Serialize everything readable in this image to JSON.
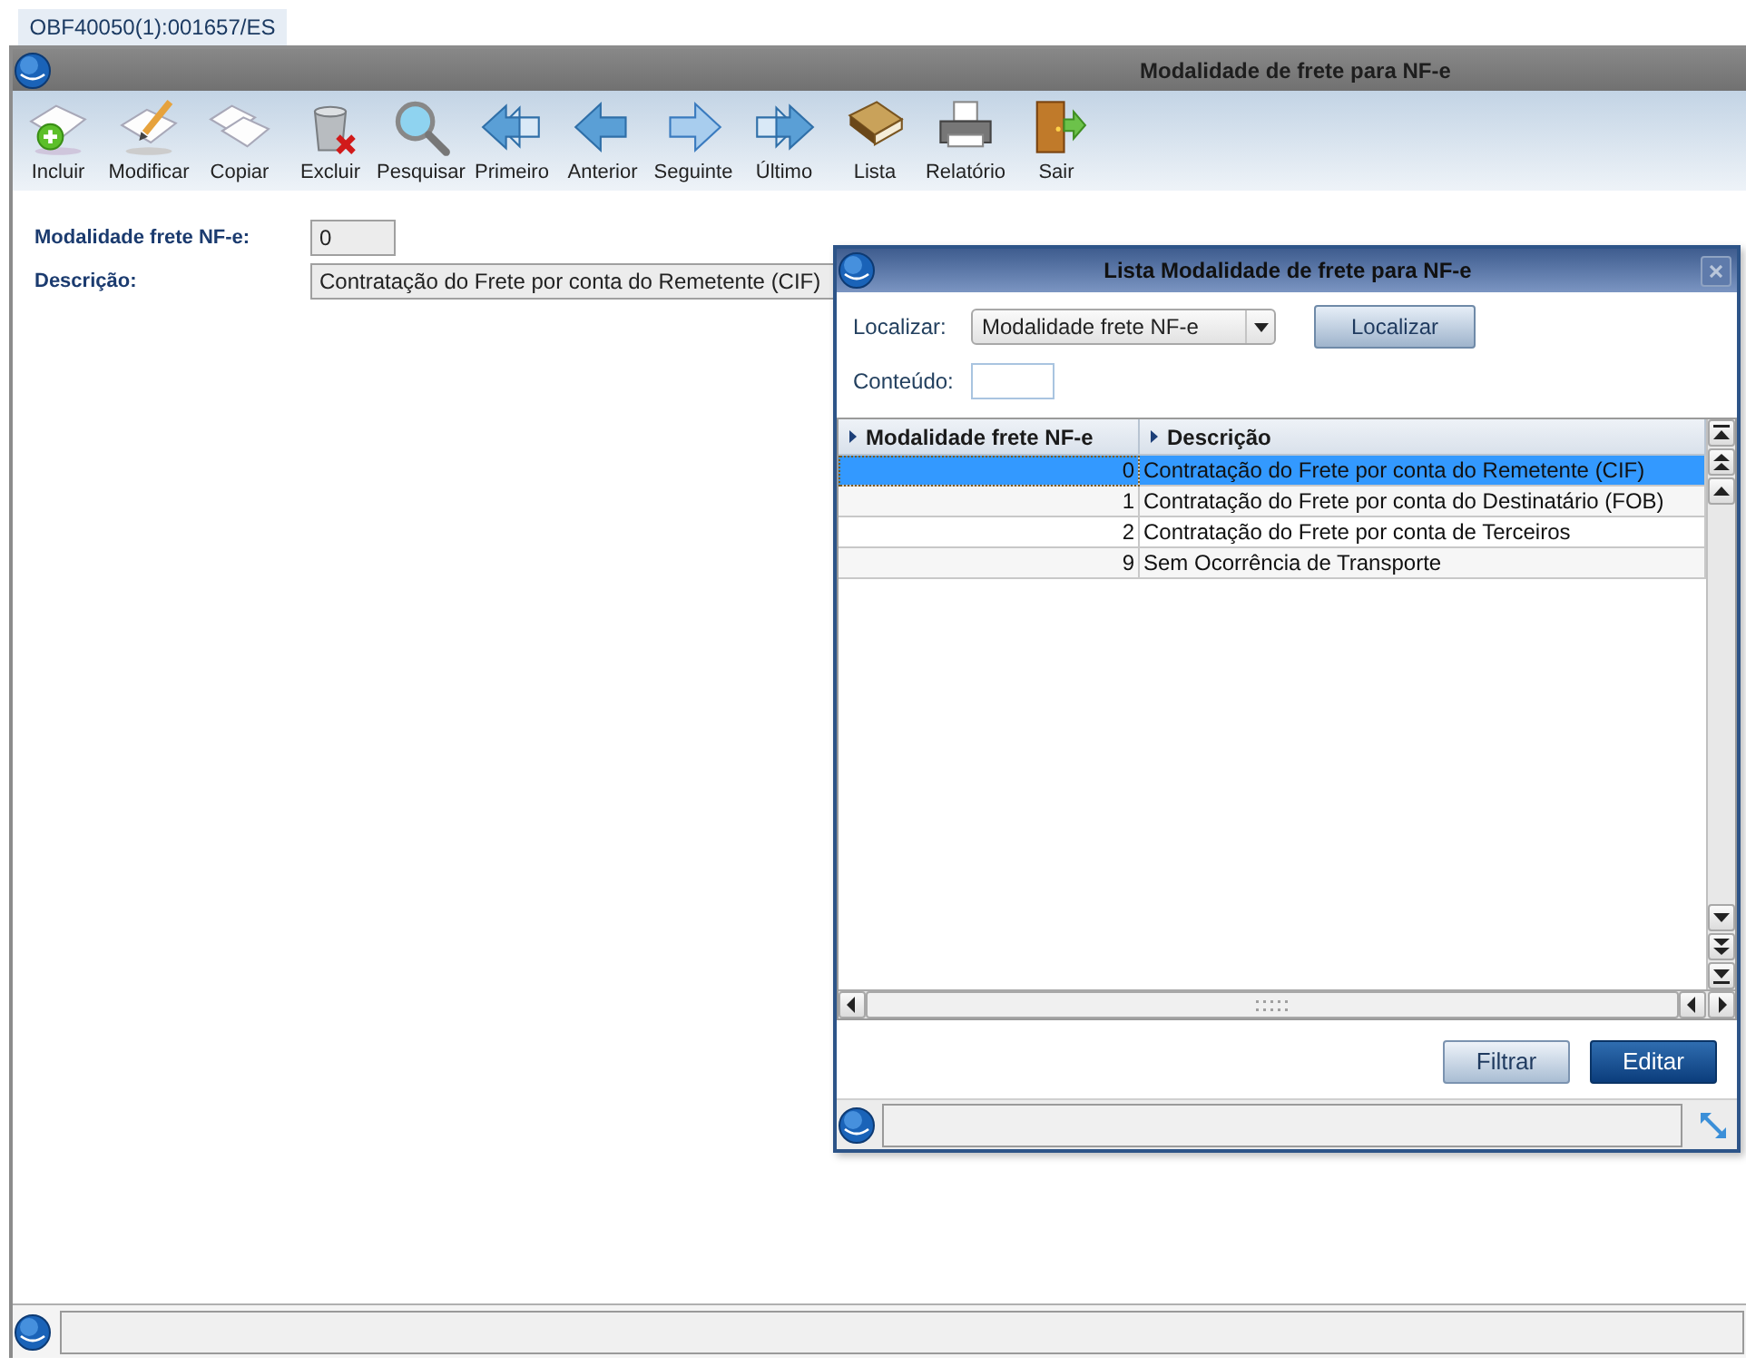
{
  "tabs": [
    {
      "label": "OBF40050(1):001657/ES",
      "selected": true
    }
  ],
  "window": {
    "title": "Modalidade de frete para NF-e"
  },
  "toolbar": [
    {
      "label": "Incluir",
      "kind": "add"
    },
    {
      "label": "Modificar",
      "kind": "edit"
    },
    {
      "label": "Copiar",
      "kind": "copy"
    },
    {
      "label": "Excluir",
      "kind": "delete"
    },
    {
      "label": "Pesquisar",
      "kind": "search"
    },
    {
      "label": "Primeiro",
      "kind": "first"
    },
    {
      "label": "Anterior",
      "kind": "previous"
    },
    {
      "label": "Seguinte",
      "kind": "next"
    },
    {
      "label": "Último",
      "kind": "last"
    },
    {
      "label": "Lista",
      "kind": "list"
    },
    {
      "label": "Relatório",
      "kind": "report"
    },
    {
      "label": "Sair",
      "kind": "exit"
    }
  ],
  "form": {
    "fields": [
      {
        "label": "Modalidade frete NF-e:",
        "value": "0"
      },
      {
        "label": "Descrição:",
        "value": "Contratação do Frete por conta do Remetente (CIF)"
      }
    ]
  },
  "dialog": {
    "title": "Lista Modalidade de frete para NF-e",
    "search": {
      "label": "Localizar:",
      "value": "Modalidade frete NF-e",
      "button": "Localizar"
    },
    "content": {
      "label": "Conteúdo:"
    },
    "table": {
      "columns": [
        "Modalidade frete NF-e",
        "Descrição"
      ],
      "rows": [
        {
          "cells": [
            "0",
            "Contratação do Frete por conta do Remetente (CIF)"
          ],
          "selected": true
        },
        {
          "cells": [
            "1",
            "Contratação do Frete por conta do Destinatário (FOB)"
          ],
          "selected": false
        },
        {
          "cells": [
            "2",
            "Contratação do Frete por conta de Terceiros"
          ],
          "selected": false
        },
        {
          "cells": [
            "9",
            "Sem Ocorrência de Transporte"
          ],
          "selected": false
        }
      ]
    },
    "buttons": [
      {
        "label": "Filtrar",
        "kind": "secondary"
      },
      {
        "label": "Editar",
        "kind": "primary"
      }
    ]
  }
}
